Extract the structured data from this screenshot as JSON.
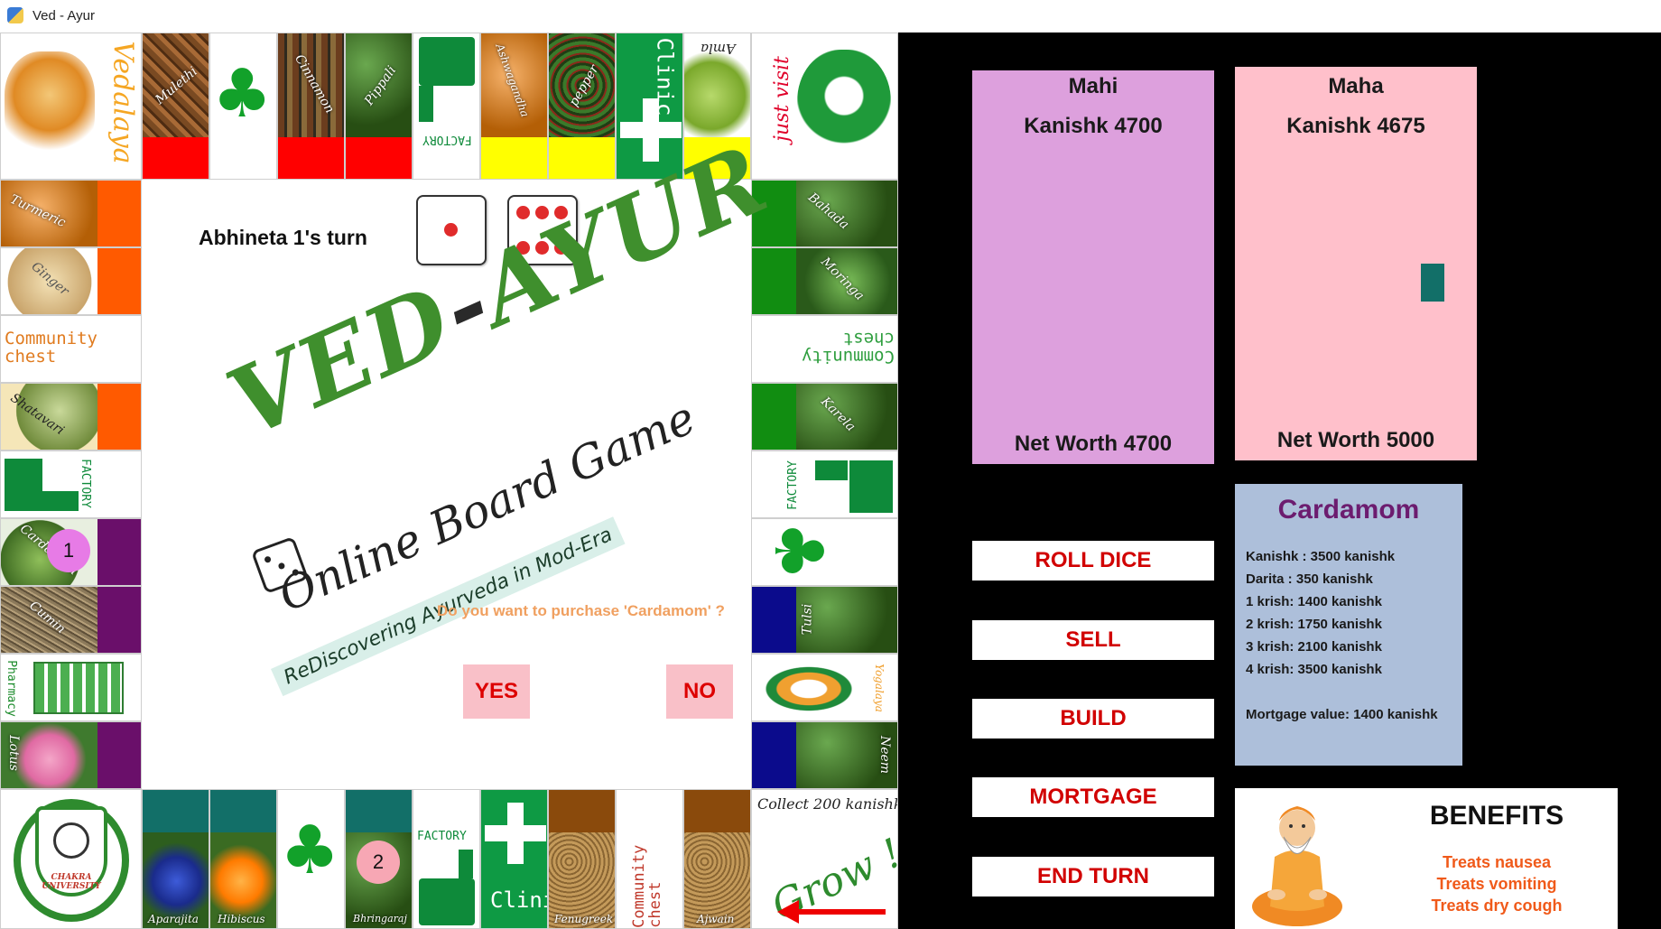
{
  "window": {
    "title": "Ved - Ayur"
  },
  "board": {
    "top_row": [
      {
        "name": "Vedalaya",
        "kind": "corner"
      },
      {
        "name": "Mulethi",
        "kind": "property",
        "color": "#ff0000"
      },
      {
        "name": "",
        "kind": "luck"
      },
      {
        "name": "Cinnamon",
        "kind": "property",
        "color": "#ff0000"
      },
      {
        "name": "Pippali",
        "kind": "property",
        "color": "#ff0000"
      },
      {
        "name": "FACTORY",
        "kind": "factory"
      },
      {
        "name": "Ashwagandha",
        "kind": "property",
        "color": "#ffff00"
      },
      {
        "name": "pepper",
        "kind": "property",
        "color": "#ffff00"
      },
      {
        "name": "Clinic",
        "kind": "clinic"
      },
      {
        "name": "Amla",
        "kind": "property",
        "color": "#ffff00"
      },
      {
        "name": "just visit",
        "kind": "corner"
      }
    ],
    "left_col": [
      {
        "name": "Turmeric",
        "kind": "property",
        "color": "#ff5a00"
      },
      {
        "name": "Ginger",
        "kind": "property",
        "color": "#ff5a00"
      },
      {
        "name": "Community chest",
        "kind": "chest"
      },
      {
        "name": "Shatavari",
        "kind": "property",
        "color": "#ff5a00"
      },
      {
        "name": "FACTORY",
        "kind": "factory"
      },
      {
        "name": "Cardamom",
        "kind": "property",
        "color": "#6a0f6a"
      },
      {
        "name": "Cumin",
        "kind": "property",
        "color": "#6a0f6a"
      },
      {
        "name": "Pharmacy",
        "kind": "pharmacy"
      },
      {
        "name": "Lotus",
        "kind": "property",
        "color": "#6a0f6a"
      }
    ],
    "right_col": [
      {
        "name": "Bahada",
        "kind": "property",
        "color": "#118d11"
      },
      {
        "name": "Moringa",
        "kind": "property",
        "color": "#118d11"
      },
      {
        "name": "Community chest",
        "kind": "chest"
      },
      {
        "name": "Karela",
        "kind": "property",
        "color": "#118d11"
      },
      {
        "name": "FACTORY",
        "kind": "factory"
      },
      {
        "name": "",
        "kind": "luck"
      },
      {
        "name": "Tulsi",
        "kind": "property",
        "color": "#0b0b8c"
      },
      {
        "name": "Yogalaya",
        "kind": "yoga"
      },
      {
        "name": "Neem",
        "kind": "property",
        "color": "#0b0b8c"
      }
    ],
    "bottom_row": [
      {
        "name": "CHAKRA UNIVERSITY",
        "kind": "corner"
      },
      {
        "name": "Aparajita",
        "kind": "property",
        "color": "#126f68"
      },
      {
        "name": "Hibiscus",
        "kind": "property",
        "color": "#126f68"
      },
      {
        "name": "",
        "kind": "luck"
      },
      {
        "name": "Bhringaraj",
        "kind": "property",
        "color": "#126f68"
      },
      {
        "name": "FACTORY",
        "kind": "factory"
      },
      {
        "name": "Clinic",
        "kind": "clinic"
      },
      {
        "name": "Fenugreek",
        "kind": "property",
        "color": "#8a4a0c"
      },
      {
        "name": "Community chest",
        "kind": "chest"
      },
      {
        "name": "Ajwain",
        "kind": "property",
        "color": "#8a4a0c"
      },
      {
        "name": "Collect 200 kanishk",
        "kind": "corner",
        "extra": "Grow !"
      }
    ],
    "turn_text": "Abhineta 1's turn",
    "dice": [
      1,
      6
    ],
    "logo": {
      "main_a": "VED",
      "dash": "-",
      "main_b": "AYUR",
      "sub": "Online Board Game",
      "tag": "ReDiscovering Ayurveda in Mod-Era"
    },
    "question": "Do you want to purchase 'Cardamom' ?",
    "yes_label": "YES",
    "no_label": "NO",
    "tokens": [
      "1",
      "2"
    ]
  },
  "players": [
    {
      "name": "Mahi",
      "money": "Kanishk 4700",
      "net_worth": "Net Worth 4700",
      "color": "#dda0dd"
    },
    {
      "name": "Maha",
      "money": "Kanishk 4675",
      "net_worth": "Net Worth 5000",
      "color": "#ffc0cb"
    }
  ],
  "actions": [
    "ROLL DICE",
    "SELL",
    "BUILD",
    "MORTGAGE",
    "END TURN"
  ],
  "property_card": {
    "title": "Cardamom",
    "rows": [
      "Kanishk :  3500 kanishk",
      "Darita :  350 kanishk",
      "1 krish: 1400 kanishk",
      "2 krish: 1750 kanishk",
      "3 krish: 2100 kanishk",
      "4 krish: 3500 kanishk",
      "Mortgage value: 1400 kanishk"
    ]
  },
  "benefits": {
    "title": "BENEFITS",
    "lines": [
      "Treats nausea",
      "Treats vomiting",
      "Treats dry cough"
    ]
  }
}
